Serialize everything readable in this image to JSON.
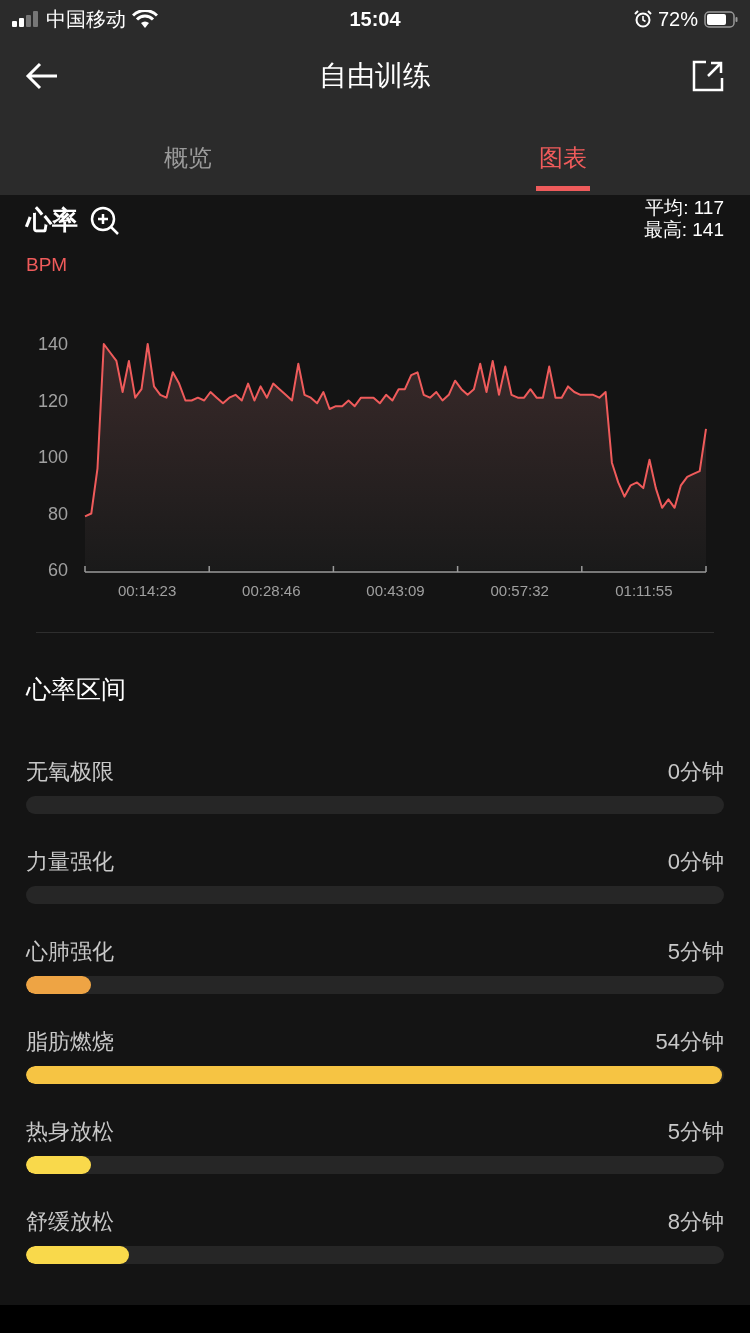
{
  "status_bar": {
    "carrier": "中国移动",
    "time": "15:04",
    "battery": "72%"
  },
  "header": {
    "title": "自由训练"
  },
  "tabs": [
    {
      "label": "概览",
      "selected": false
    },
    {
      "label": "图表",
      "selected": true
    }
  ],
  "heart_rate": {
    "title": "心率",
    "average": "平均: 117",
    "max": "最高: 141",
    "unit": "BPM",
    "time_labels": [
      "00:14:23",
      "00:28:46",
      "00:43:09",
      "00:57:32",
      "01:11:55"
    ],
    "chart_data": {
      "type": "area",
      "ylim": [
        60,
        140
      ],
      "yticks": [
        60,
        80,
        100,
        120,
        140
      ],
      "series": [
        {
          "color": "#ef5b5b",
          "values": [
            79,
            80,
            96,
            140,
            137,
            134,
            123,
            134,
            121,
            124,
            140,
            125,
            122,
            121,
            130,
            126,
            120,
            120,
            121,
            120,
            123,
            121,
            119,
            121,
            122,
            120,
            126,
            120,
            125,
            121,
            126,
            124,
            122,
            120,
            133,
            122,
            121,
            119,
            123,
            117,
            118,
            118,
            120,
            118,
            121,
            121,
            121,
            119,
            122,
            120,
            124,
            124,
            129,
            130,
            122,
            121,
            123,
            120,
            122,
            127,
            124,
            122,
            124,
            133,
            123,
            134,
            122,
            132,
            122,
            121,
            121,
            124,
            121,
            121,
            132,
            121,
            121,
            125,
            123,
            122,
            122,
            122,
            121,
            123,
            98,
            91,
            86,
            90,
            91,
            89,
            99,
            89,
            82,
            85,
            82,
            90,
            93,
            94,
            95,
            110
          ]
        }
      ]
    }
  },
  "zones": {
    "title": "心率区间",
    "items": [
      {
        "name": "无氧极限",
        "duration": "0分钟"
      },
      {
        "name": "力量强化",
        "duration": "0分钟"
      },
      {
        "name": "心肺强化",
        "duration": "5分钟",
        "level": 0.093,
        "color": "#eea444"
      },
      {
        "name": "脂肪燃烧",
        "duration": "54分钟",
        "level": 1,
        "color": "#f6c443"
      },
      {
        "name": "热身放松",
        "duration": "5分钟",
        "level": 0.093,
        "color": "#f9d94b"
      },
      {
        "name": "舒缓放松",
        "duration": "8分钟",
        "level": 0.148,
        "color": "#f9d94b"
      }
    ]
  }
}
